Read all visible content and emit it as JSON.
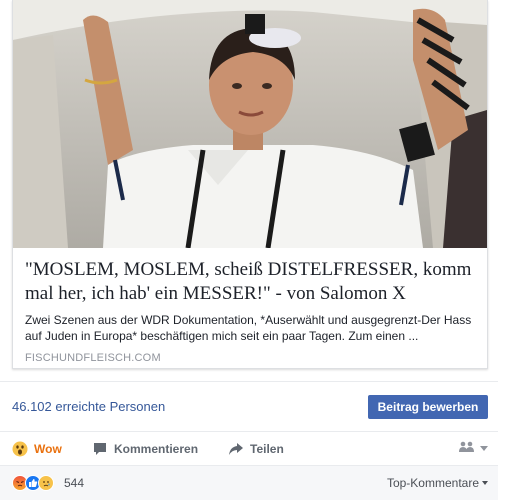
{
  "link_preview": {
    "image_alt": "",
    "title": "\"MOSLEM, MOSLEM, scheiß DISTELFRESSER, komm mal her, ich hab' ein MESSER!\" - von Salomon X",
    "description": "Zwei Szenen aus der WDR Dokumentation, *Auserwählt und ausgegrenzt-Der Hass auf Juden in Europa* beschäftigen mich seit ein paar Tagen. Zum einen ...",
    "domain": "FISCHUNDFLEISCH.COM"
  },
  "reach": {
    "text": "46.102 erreichte Personen",
    "boost_label": "Beitrag bewerben"
  },
  "actions": {
    "wow_label": "Wow",
    "comment_label": "Kommentieren",
    "share_label": "Teilen"
  },
  "reactions": {
    "count": "544",
    "sort_label": "Top-Kommentare"
  },
  "colors": {
    "link_blue": "#365899",
    "button_blue": "#4267b2",
    "wow_orange": "#e9710f"
  }
}
